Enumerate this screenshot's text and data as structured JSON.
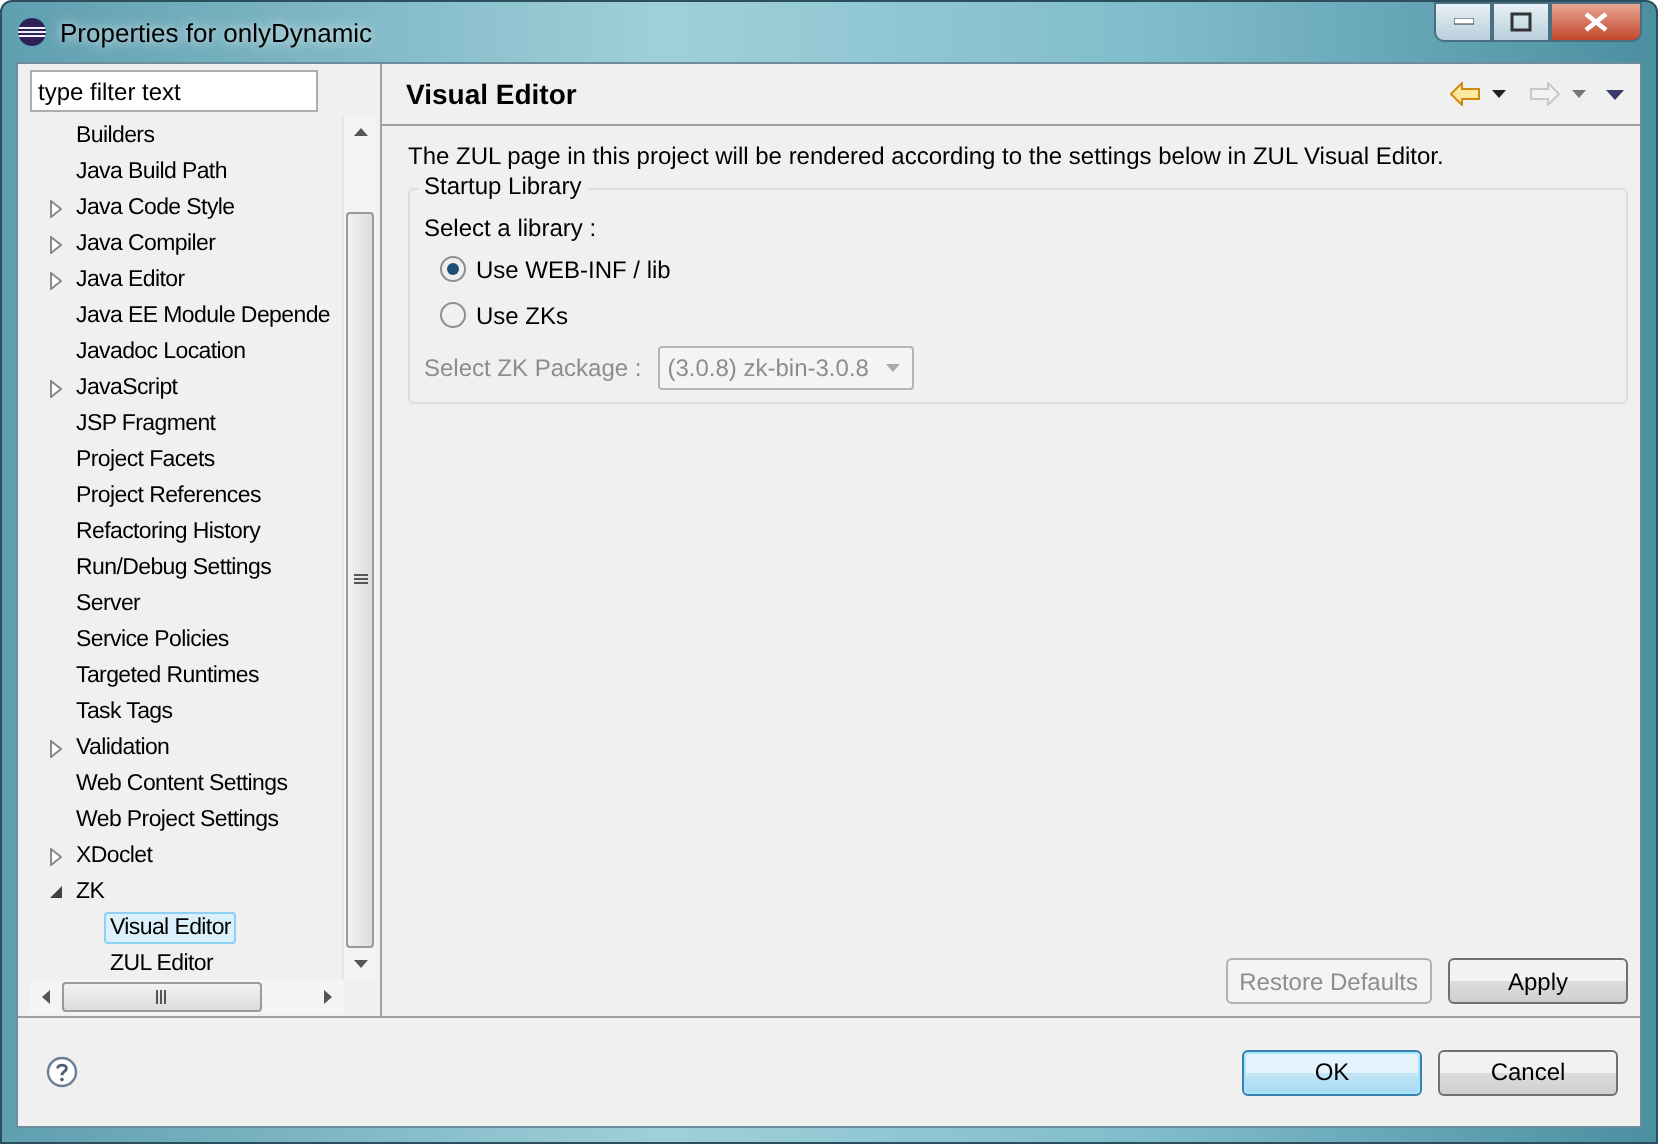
{
  "window": {
    "title": "Properties for onlyDynamic"
  },
  "filter": {
    "placeholder": "type filter text"
  },
  "tree": [
    {
      "label": "Builders",
      "kind": "leaf",
      "selected": false
    },
    {
      "label": "Java Build Path",
      "kind": "leaf",
      "selected": false
    },
    {
      "label": "Java Code Style",
      "kind": "collapsed",
      "selected": false
    },
    {
      "label": "Java Compiler",
      "kind": "collapsed",
      "selected": false
    },
    {
      "label": "Java Editor",
      "kind": "collapsed",
      "selected": false
    },
    {
      "label": "Java EE Module Depende",
      "kind": "leaf",
      "selected": false
    },
    {
      "label": "Javadoc Location",
      "kind": "leaf",
      "selected": false
    },
    {
      "label": "JavaScript",
      "kind": "collapsed",
      "selected": false
    },
    {
      "label": "JSP Fragment",
      "kind": "leaf",
      "selected": false
    },
    {
      "label": "Project Facets",
      "kind": "leaf",
      "selected": false
    },
    {
      "label": "Project References",
      "kind": "leaf",
      "selected": false
    },
    {
      "label": "Refactoring History",
      "kind": "leaf",
      "selected": false
    },
    {
      "label": "Run/Debug Settings",
      "kind": "leaf",
      "selected": false
    },
    {
      "label": "Server",
      "kind": "leaf",
      "selected": false
    },
    {
      "label": "Service Policies",
      "kind": "leaf",
      "selected": false
    },
    {
      "label": "Targeted Runtimes",
      "kind": "leaf",
      "selected": false
    },
    {
      "label": "Task Tags",
      "kind": "leaf",
      "selected": false
    },
    {
      "label": "Validation",
      "kind": "collapsed",
      "selected": false
    },
    {
      "label": "Web Content Settings",
      "kind": "leaf",
      "selected": false
    },
    {
      "label": "Web Project Settings",
      "kind": "leaf",
      "selected": false
    },
    {
      "label": "XDoclet",
      "kind": "collapsed",
      "selected": false
    },
    {
      "label": "ZK",
      "kind": "expanded",
      "selected": false,
      "children": [
        {
          "label": "Visual Editor",
          "selected": true
        },
        {
          "label": "ZUL Editor",
          "selected": false
        }
      ]
    }
  ],
  "page": {
    "title": "Visual Editor",
    "description": "The ZUL page in this project will be rendered according to the settings below in ZUL Visual Editor.",
    "group": {
      "title": "Startup Library",
      "prompt": "Select a library :",
      "options": [
        {
          "label": "Use WEB-INF / lib",
          "selected": true
        },
        {
          "label": "Use ZKs",
          "selected": false
        }
      ],
      "package": {
        "label": "Select ZK Package :",
        "value": "(3.0.8)  zk-bin-3.0.8",
        "disabled": true
      }
    }
  },
  "page_buttons": [
    {
      "label": "Restore Defaults",
      "disabled": true
    },
    {
      "label": "Apply",
      "disabled": false
    }
  ],
  "dialog_buttons": [
    {
      "label": "OK",
      "default": true
    },
    {
      "label": "Cancel",
      "default": false
    }
  ]
}
